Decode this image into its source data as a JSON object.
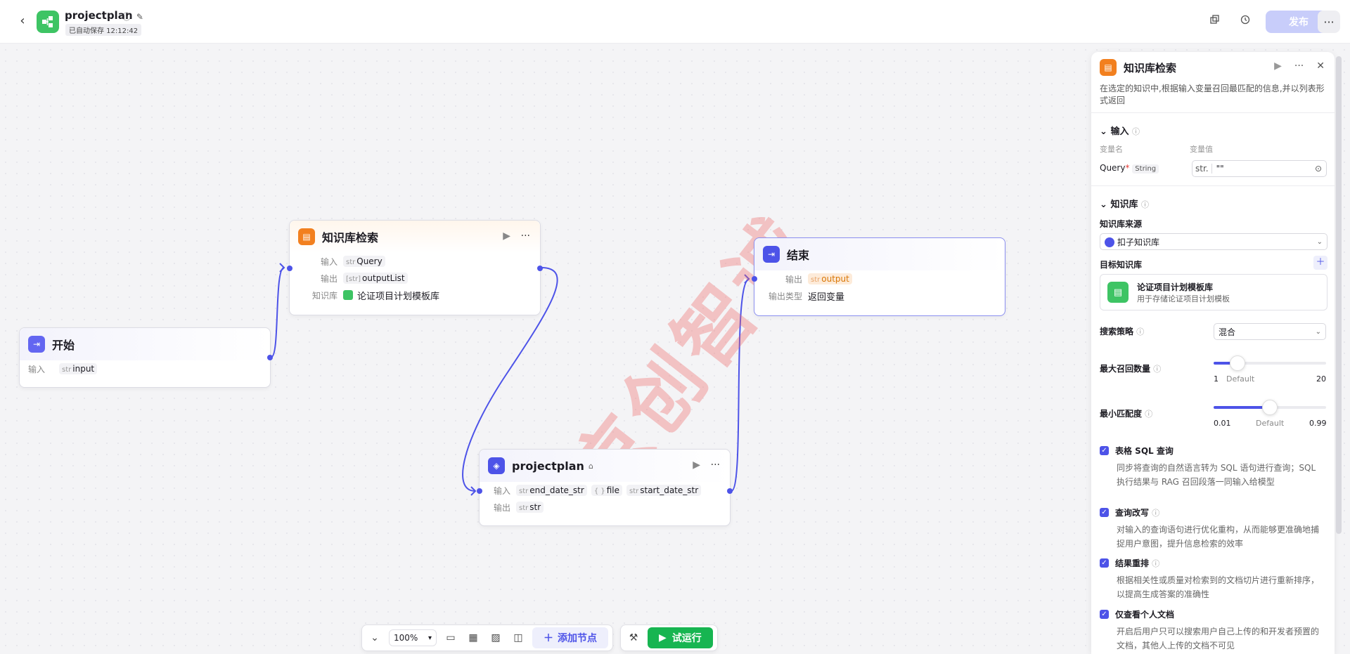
{
  "topbar": {
    "back_icon": "‹",
    "app_title": "projectplan",
    "saved_text": "已自动保存 12:12:42",
    "publish_label": "发布",
    "more_label": "···"
  },
  "canvas": {
    "watermark": "京创智诚",
    "nodes": {
      "start": {
        "title": "开始",
        "input_label": "输入",
        "input_type": "str",
        "input_name": "input"
      },
      "kb": {
        "title": "知识库检索",
        "input_label": "输入",
        "input_type": "str",
        "input_name": "Query",
        "output_label": "输出",
        "output_type": "[str]",
        "output_name": "outputList",
        "kb_label": "知识库",
        "kb_name": "论证项目计划模板库"
      },
      "end": {
        "title": "结束",
        "output_label": "输出",
        "output_type": "str",
        "output_name": "output",
        "otype_label": "输出类型",
        "otype_value": "返回变量"
      },
      "plan": {
        "title": "projectplan",
        "input_label": "输入",
        "in1_type": "str",
        "in1": "end_date_str",
        "in2_type": "{ }",
        "in2": "file",
        "in3_type": "str",
        "in3": "start_date_str",
        "output_label": "输出",
        "out_type": "str",
        "out": "str"
      }
    }
  },
  "bottom": {
    "zoom": "100%",
    "add_node": "添加节点",
    "run": "试运行"
  },
  "panel": {
    "title": "知识库检索",
    "desc": "在选定的知识中,根据输入变量召回最匹配的信息,并以列表形式返回",
    "input_section": "输入",
    "var_name_col": "变量名",
    "var_value_col": "变量值",
    "query_label": "Query",
    "query_required": "*",
    "query_type": "String",
    "query_prefix": "str.",
    "query_value": "\"\"",
    "kb_section": "知识库",
    "kb_source_label": "知识库来源",
    "kb_source_value": "扣子知识库",
    "target_kb_label": "目标知识库",
    "kb_card_name": "论证项目计划模板库",
    "kb_card_desc": "用于存储论证项目计划模板",
    "strategy_label": "搜索策略",
    "strategy_value": "混合",
    "max_recall_label": "最大召回数量",
    "max_recall_min": "1",
    "max_recall_default": "Default",
    "max_recall_max": "20",
    "max_recall_value": 5,
    "min_match_label": "最小匹配度",
    "min_match_min": "0.01",
    "min_match_default": "Default",
    "min_match_max": "0.99",
    "min_match_value": 0.5,
    "cb1_label": "表格 SQL 查询",
    "cb1_desc": "同步将查询的自然语言转为 SQL 语句进行查询；SQL 执行结果与 RAG 召回段落一同输入给模型",
    "cb2_label": "查询改写",
    "cb2_desc": "对输入的查询语句进行优化重构，从而能够更准确地捕捉用户意图，提升信息检索的效率",
    "cb3_label": "结果重排",
    "cb3_desc": "根据相关性或质量对检索到的文档切片进行重新排序，以提高生成答案的准确性",
    "cb4_label": "仅查看个人文档",
    "cb4_desc": "开启后用户只可以搜索用户自己上传的和开发者预置的文档，其他人上传的文档不可见"
  },
  "colors": {
    "accent": "#4d53e8",
    "kb_orange": "#f2801f",
    "green": "#17b551",
    "start_purple": "#6366f1"
  }
}
